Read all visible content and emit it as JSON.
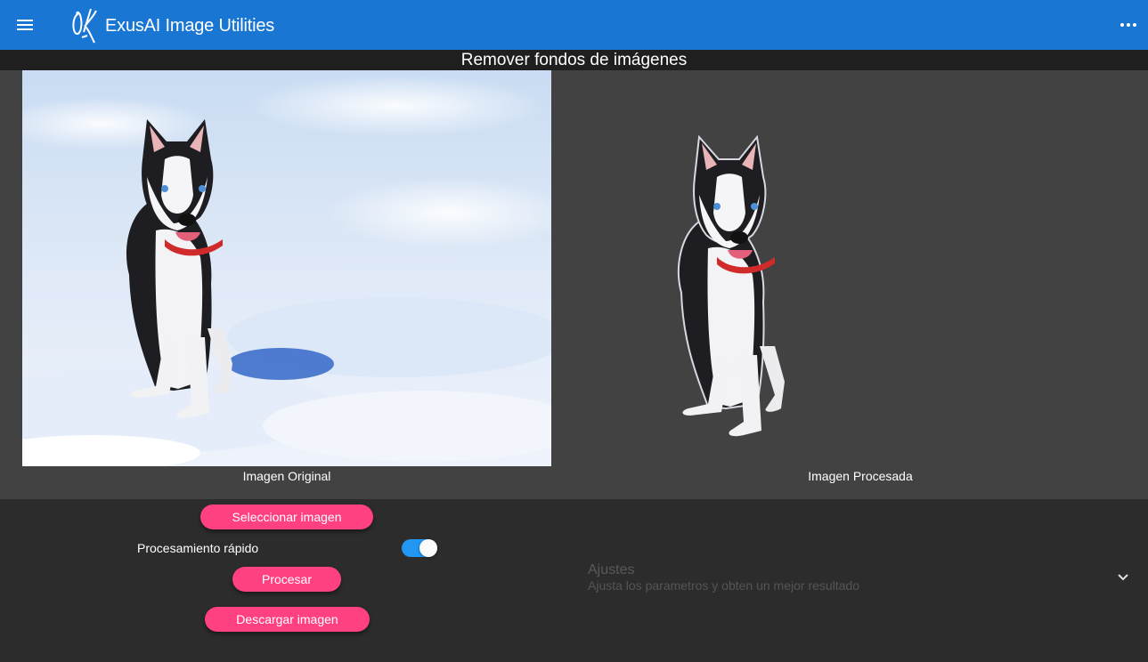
{
  "appbar": {
    "title": "ExusAI Image Utilities",
    "color": "#1976d2",
    "menu_icon": "hamburger-menu-icon",
    "more_icon": "more-horiz-icon"
  },
  "page": {
    "title": "Remover fondos de imágenes"
  },
  "images": {
    "original_caption": "Imagen Original",
    "processed_caption": "Imagen Procesada",
    "original_image_alt": "husky-in-snow-image",
    "processed_image_alt": "husky-cutout-image"
  },
  "controls": {
    "select_label": "Seleccionar imagen",
    "fast_label": "Procesamiento rápido",
    "fast_enabled": true,
    "process_label": "Procesar",
    "download_label": "Descargar imagen",
    "accent": "#ff4081",
    "toggle_color": "#2196f3"
  },
  "settings": {
    "title": "Ajustes",
    "subtitle": "Ajusta los parametros y obten un mejor resultado",
    "expand_icon": "chevron-down-icon"
  }
}
